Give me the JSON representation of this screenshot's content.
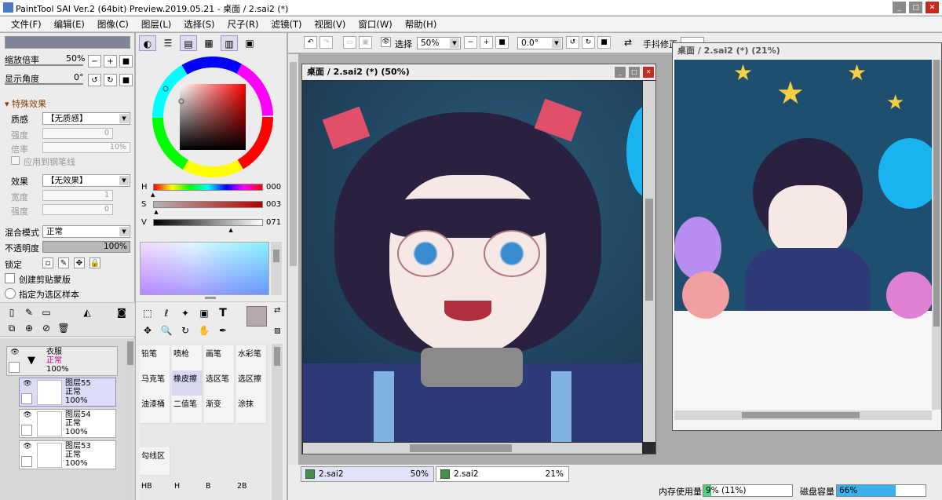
{
  "app": {
    "title": "PaintTool SAI Ver.2 (64bit) Preview.2019.05.21 - 桌面 / 2.sai2 (*)"
  },
  "window_controls": {
    "minimize": "_",
    "maximize": "□",
    "close": "✕"
  },
  "menu": [
    "文件(F)",
    "编辑(E)",
    "图像(C)",
    "图层(L)",
    "选择(S)",
    "尺子(R)",
    "滤镜(T)",
    "视图(V)",
    "窗口(W)",
    "帮助(H)"
  ],
  "navigator": {
    "zoom_label": "缩放倍率",
    "zoom_value": "50%",
    "angle_label": "显示角度",
    "angle_value": "0°"
  },
  "effects": {
    "header": "特殊效果",
    "texture_label": "质感",
    "texture_value": "【无质感】",
    "strength_label": "强度",
    "strength_value": "0",
    "scale_label": "倍率",
    "scale_value": "10%",
    "apply_brush": "应用到钢笔线",
    "effect_label": "效果",
    "effect_value": "【无效果】",
    "width_label": "宽度",
    "width_value": "1",
    "intensity_label": "强度",
    "intensity_value": "0"
  },
  "layer_props": {
    "blend_label": "混合模式",
    "blend_value": "正常",
    "opacity_label": "不透明度",
    "opacity_value": "100%",
    "opacity": 1.0,
    "lock_label": "锁定",
    "clip_label": "创建剪贴蒙版",
    "sample_label": "指定为选区样本"
  },
  "layers": [
    {
      "name": "衣服",
      "mode": "正常",
      "opacity": "100%",
      "type": "folder"
    },
    {
      "name": "图层55",
      "mode": "正常",
      "opacity": "100%",
      "selected": true
    },
    {
      "name": "图层54",
      "mode": "正常",
      "opacity": "100%"
    },
    {
      "name": "图层53",
      "mode": "正常",
      "opacity": "100%"
    }
  ],
  "color": {
    "h_label": "H",
    "h_value": "000",
    "s_label": "S",
    "s_value": "003",
    "v_label": "V",
    "v_value": "071",
    "h_level": 0.0,
    "s_level": 0.03,
    "v_level": 0.71,
    "current_color": "#b5a9ad"
  },
  "tools": {
    "text_icon": "T"
  },
  "brushes": [
    {
      "label": "铅笔"
    },
    {
      "label": "喷枪"
    },
    {
      "label": "画笔"
    },
    {
      "label": "水彩笔"
    },
    {
      "label": "马克笔"
    },
    {
      "label": "橡皮擦",
      "active": true
    },
    {
      "label": "选区笔"
    },
    {
      "label": "选区擦"
    },
    {
      "label": "油漆桶"
    },
    {
      "label": "二值笔"
    },
    {
      "label": "渐变"
    },
    {
      "label": "涂抹"
    },
    {
      "label": "勾线区"
    }
  ],
  "brush_params": [
    "HB",
    "H",
    "B",
    "2B"
  ],
  "canvas_toolbar": {
    "select_label": "选择",
    "zoom_value": "50%",
    "angle_value": "0.0°",
    "stabilizer_label": "手抖修正"
  },
  "windows": [
    {
      "title": "桌面 / 2.sai2 (*) (50%)"
    },
    {
      "title": "桌面 / 2.sai2 (*) (21%)"
    }
  ],
  "doc_tabs": [
    {
      "name": "2.sai2",
      "zoom": "50%"
    },
    {
      "name": "2.sai2",
      "zoom": "21%"
    }
  ],
  "status": {
    "memory_label": "内存使用量",
    "memory_value": "9% (11%)",
    "memory_level": 0.09,
    "disk_label": "磁盘容量",
    "disk_value": "66%",
    "disk_level": 0.66
  }
}
